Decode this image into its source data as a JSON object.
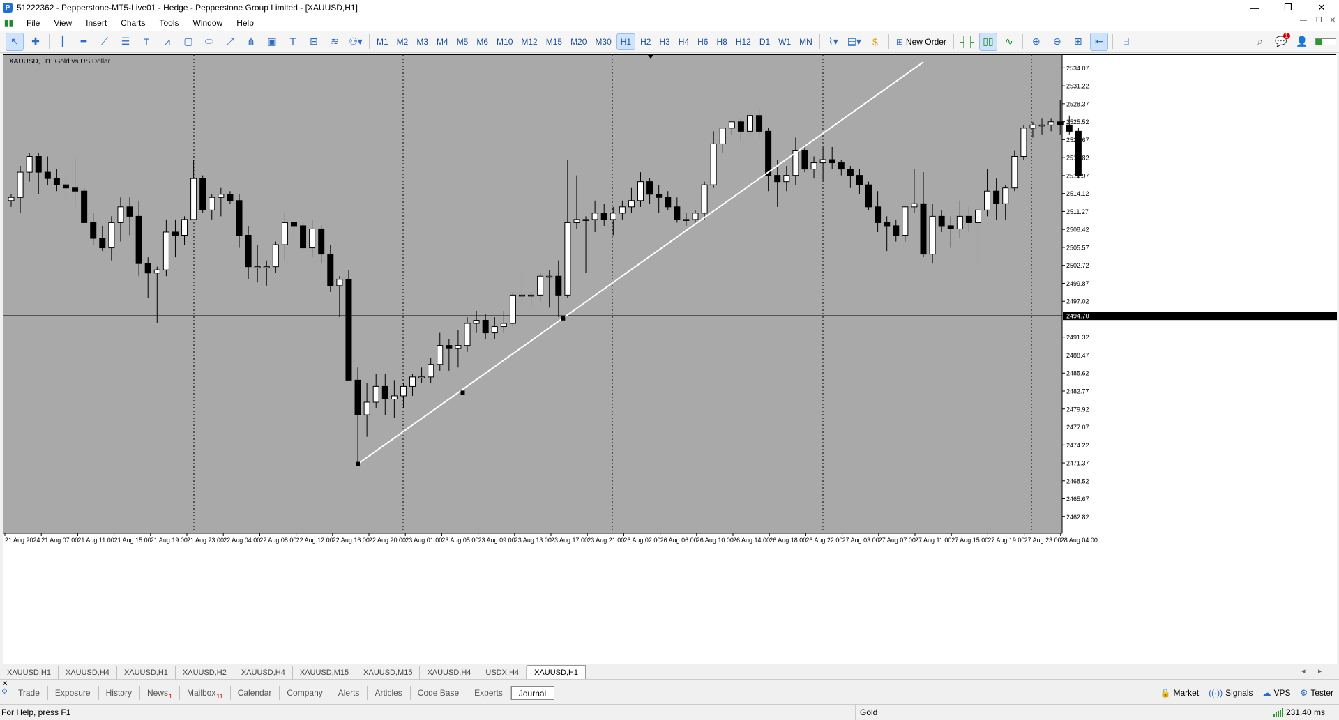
{
  "window": {
    "title": "51222362 - Pepperstone-MT5-Live01 - Hedge - Pepperstone Group Limited - [XAUUSD,H1]",
    "minimize": "—",
    "maximize": "❐",
    "close": "✕"
  },
  "menu": {
    "items": [
      "File",
      "View",
      "Insert",
      "Charts",
      "Tools",
      "Window",
      "Help"
    ]
  },
  "toolbar": {
    "drawing_tools": [
      "cursor-icon",
      "crosshair-icon",
      "vertical-line-icon",
      "horizontal-line-icon",
      "trendline-icon",
      "channel-icon",
      "text-icon",
      "fibonacci-icon",
      "rectangle-icon",
      "ellipse-icon",
      "arrow-icon",
      "pitchfork-icon",
      "gann-icon",
      "text-label-icon",
      "cycle-lines-icon",
      "regression-icon",
      "shapes-icon"
    ],
    "timeframes": [
      "M1",
      "M2",
      "M3",
      "M4",
      "M5",
      "M6",
      "M10",
      "M12",
      "M15",
      "M20",
      "M30",
      "H1",
      "H2",
      "H3",
      "H4",
      "H6",
      "H8",
      "H12",
      "D1",
      "W1",
      "MN"
    ],
    "active_timeframe": "H1",
    "new_order_label": "New Order",
    "notification_count": "1"
  },
  "chart": {
    "label": "XAUUSD, H1:  Gold vs US Dollar",
    "current_price": "2494.70",
    "bg_color": "#a9a9a9",
    "bull_color": "#ffffff",
    "bear_color": "#000000"
  },
  "chart_data": {
    "type": "candlestick",
    "symbol": "XAUUSD",
    "timeframe": "H1",
    "ylim": [
      2460.2,
      2536.1
    ],
    "y_ticks": [
      "2534.07",
      "2531.22",
      "2528.37",
      "2525.52",
      "2522.67",
      "2519.82",
      "2516.97",
      "2514.12",
      "2511.27",
      "2508.42",
      "2505.57",
      "2502.72",
      "2499.87",
      "2497.02",
      "2494.70",
      "2491.32",
      "2488.47",
      "2485.62",
      "2482.77",
      "2479.92",
      "2477.07",
      "2474.22",
      "2471.37",
      "2468.52",
      "2465.67",
      "2462.82"
    ],
    "x_ticks": [
      "21 Aug 2024",
      "21 Aug 07:00",
      "21 Aug 11:00",
      "21 Aug 15:00",
      "21 Aug 19:00",
      "21 Aug 23:00",
      "22 Aug 04:00",
      "22 Aug 08:00",
      "22 Aug 12:00",
      "22 Aug 16:00",
      "22 Aug 20:00",
      "23 Aug 01:00",
      "23 Aug 05:00",
      "23 Aug 09:00",
      "23 Aug 13:00",
      "23 Aug 17:00",
      "23 Aug 21:00",
      "26 Aug 02:00",
      "26 Aug 06:00",
      "26 Aug 10:00",
      "26 Aug 14:00",
      "26 Aug 18:00",
      "26 Aug 22:00",
      "27 Aug 03:00",
      "27 Aug 07:00",
      "27 Aug 11:00",
      "27 Aug 15:00",
      "27 Aug 19:00",
      "27 Aug 23:00",
      "28 Aug 04:00"
    ],
    "horizontal_line": 2494.7,
    "candles": [
      [
        2513.0,
        2514.0,
        2512.0,
        2513.5
      ],
      [
        2513.5,
        2518.5,
        2511.0,
        2517.5
      ],
      [
        2517.5,
        2520.5,
        2516.0,
        2520.0
      ],
      [
        2520.0,
        2520.5,
        2514.0,
        2517.5
      ],
      [
        2517.5,
        2520.0,
        2515.5,
        2516.5
      ],
      [
        2516.5,
        2518.0,
        2514.5,
        2515.5
      ],
      [
        2515.5,
        2517.5,
        2512.5,
        2515.0
      ],
      [
        2515.0,
        2520.0,
        2512.0,
        2514.5
      ],
      [
        2514.5,
        2515.0,
        2509.5,
        2509.5
      ],
      [
        2509.5,
        2511.0,
        2506.0,
        2507.0
      ],
      [
        2507.0,
        2509.0,
        2505.0,
        2505.5
      ],
      [
        2505.5,
        2510.5,
        2503.5,
        2509.5
      ],
      [
        2509.5,
        2513.5,
        2506.5,
        2512.0
      ],
      [
        2512.0,
        2513.5,
        2507.5,
        2510.5
      ],
      [
        2510.5,
        2513.0,
        2501.0,
        2503.0
      ],
      [
        2503.0,
        2504.0,
        2497.5,
        2501.5
      ],
      [
        2501.5,
        2502.5,
        2493.5,
        2502.0
      ],
      [
        2502.0,
        2510.0,
        2501.0,
        2508.0
      ],
      [
        2508.0,
        2510.0,
        2504.0,
        2507.5
      ],
      [
        2507.5,
        2510.5,
        2506.0,
        2510.0
      ],
      [
        2510.0,
        2519.5,
        2510.0,
        2516.5
      ],
      [
        2516.5,
        2517.0,
        2511.0,
        2511.5
      ],
      [
        2511.5,
        2514.0,
        2510.0,
        2513.5
      ],
      [
        2513.5,
        2515.0,
        2510.5,
        2514.0
      ],
      [
        2514.0,
        2514.5,
        2512.5,
        2513.0
      ],
      [
        2513.0,
        2514.0,
        2505.5,
        2507.5
      ],
      [
        2507.5,
        2509.0,
        2500.5,
        2502.5
      ],
      [
        2502.5,
        2506.0,
        2500.0,
        2502.5
      ],
      [
        2502.5,
        2503.5,
        2499.5,
        2502.5
      ],
      [
        2502.5,
        2506.5,
        2501.5,
        2506.0
      ],
      [
        2506.0,
        2511.0,
        2503.5,
        2509.5
      ],
      [
        2509.5,
        2510.0,
        2506.0,
        2509.0
      ],
      [
        2509.0,
        2509.5,
        2505.5,
        2505.5
      ],
      [
        2505.5,
        2510.0,
        2504.0,
        2508.5
      ],
      [
        2508.5,
        2509.0,
        2503.0,
        2504.5
      ],
      [
        2504.5,
        2506.0,
        2498.5,
        2499.5
      ],
      [
        2499.5,
        2501.0,
        2494.5,
        2500.5
      ],
      [
        2500.5,
        2502.0,
        2484.5,
        2484.5
      ],
      [
        2484.5,
        2486.5,
        2471.5,
        2479.0
      ],
      [
        2479.0,
        2484.0,
        2475.5,
        2481.0
      ],
      [
        2481.0,
        2485.5,
        2480.0,
        2483.5
      ],
      [
        2483.5,
        2485.5,
        2479.0,
        2481.5
      ],
      [
        2481.5,
        2484.5,
        2478.5,
        2482.0
      ],
      [
        2482.0,
        2484.0,
        2480.0,
        2483.5
      ],
      [
        2483.5,
        2485.5,
        2482.0,
        2485.0
      ],
      [
        2485.0,
        2486.5,
        2484.0,
        2485.0
      ],
      [
        2485.0,
        2488.0,
        2484.0,
        2487.0
      ],
      [
        2487.0,
        2492.0,
        2486.0,
        2490.0
      ],
      [
        2490.0,
        2491.0,
        2486.0,
        2489.5
      ],
      [
        2489.5,
        2492.5,
        2486.5,
        2490.0
      ],
      [
        2490.0,
        2494.5,
        2489.0,
        2493.5
      ],
      [
        2493.5,
        2495.5,
        2492.0,
        2494.0
      ],
      [
        2494.0,
        2495.0,
        2491.0,
        2492.0
      ],
      [
        2492.0,
        2494.5,
        2491.0,
        2493.0
      ],
      [
        2493.0,
        2495.5,
        2492.0,
        2493.5
      ],
      [
        2493.5,
        2498.5,
        2493.0,
        2498.0
      ],
      [
        2498.0,
        2502.0,
        2496.5,
        2498.0
      ],
      [
        2498.0,
        2498.5,
        2496.0,
        2498.0
      ],
      [
        2498.0,
        2501.5,
        2497.0,
        2501.0
      ],
      [
        2501.0,
        2502.0,
        2496.0,
        2501.0
      ],
      [
        2501.0,
        2503.5,
        2494.5,
        2498.0
      ],
      [
        2498.0,
        2519.5,
        2497.5,
        2509.5
      ],
      [
        2509.5,
        2517.0,
        2508.5,
        2510.0
      ],
      [
        2510.0,
        2510.5,
        2501.5,
        2510.0
      ],
      [
        2510.0,
        2513.0,
        2508.0,
        2511.0
      ],
      [
        2511.0,
        2512.5,
        2509.0,
        2510.0
      ],
      [
        2510.0,
        2512.0,
        2507.5,
        2511.0
      ],
      [
        2511.0,
        2513.0,
        2510.0,
        2512.0
      ],
      [
        2512.0,
        2515.0,
        2511.0,
        2513.0
      ],
      [
        2513.0,
        2517.5,
        2512.0,
        2516.0
      ],
      [
        2516.0,
        2516.5,
        2512.5,
        2514.0
      ],
      [
        2514.0,
        2515.5,
        2511.0,
        2513.5
      ],
      [
        2513.5,
        2514.5,
        2511.5,
        2512.0
      ],
      [
        2512.0,
        2513.5,
        2509.5,
        2510.0
      ],
      [
        2510.0,
        2511.0,
        2509.0,
        2510.0
      ],
      [
        2510.0,
        2511.5,
        2509.5,
        2511.0
      ],
      [
        2511.0,
        2516.0,
        2510.0,
        2515.5
      ],
      [
        2515.5,
        2524.0,
        2515.0,
        2522.0
      ],
      [
        2522.0,
        2524.5,
        2520.5,
        2524.5
      ],
      [
        2524.5,
        2525.5,
        2523.5,
        2525.5
      ],
      [
        2525.5,
        2526.0,
        2522.5,
        2524.0
      ],
      [
        2524.0,
        2527.0,
        2523.0,
        2526.5
      ],
      [
        2526.5,
        2527.5,
        2523.0,
        2524.0
      ],
      [
        2524.0,
        2524.5,
        2514.5,
        2517.0
      ],
      [
        2517.0,
        2519.5,
        2512.0,
        2516.0
      ],
      [
        2516.0,
        2518.5,
        2514.5,
        2517.0
      ],
      [
        2517.0,
        2523.0,
        2515.5,
        2521.0
      ],
      [
        2521.0,
        2521.5,
        2517.5,
        2518.0
      ],
      [
        2518.0,
        2520.0,
        2516.5,
        2519.0
      ],
      [
        2519.0,
        2521.5,
        2516.0,
        2519.5
      ],
      [
        2519.5,
        2521.5,
        2518.0,
        2519.0
      ],
      [
        2519.0,
        2519.5,
        2517.0,
        2518.0
      ],
      [
        2518.0,
        2518.5,
        2515.0,
        2517.0
      ],
      [
        2517.0,
        2518.0,
        2514.0,
        2515.5
      ],
      [
        2515.5,
        2516.0,
        2511.5,
        2512.0
      ],
      [
        2512.0,
        2514.5,
        2508.0,
        2509.5
      ],
      [
        2509.5,
        2510.5,
        2505.0,
        2509.0
      ],
      [
        2509.0,
        2510.0,
        2506.5,
        2507.5
      ],
      [
        2507.5,
        2512.0,
        2506.5,
        2512.0
      ],
      [
        2512.0,
        2518.0,
        2511.0,
        2512.5
      ],
      [
        2512.5,
        2517.5,
        2504.0,
        2504.5
      ],
      [
        2504.5,
        2512.5,
        2503.0,
        2510.5
      ],
      [
        2510.5,
        2511.5,
        2508.0,
        2509.0
      ],
      [
        2509.0,
        2510.5,
        2505.5,
        2508.5
      ],
      [
        2508.5,
        2513.0,
        2507.0,
        2510.5
      ],
      [
        2510.5,
        2512.0,
        2508.0,
        2509.5
      ],
      [
        2509.5,
        2512.5,
        2503.0,
        2511.5
      ],
      [
        2511.5,
        2518.0,
        2510.5,
        2514.5
      ],
      [
        2514.5,
        2516.5,
        2510.0,
        2512.5
      ],
      [
        2512.5,
        2515.5,
        2510.0,
        2515.0
      ],
      [
        2515.0,
        2521.0,
        2514.5,
        2520.0
      ],
      [
        2520.0,
        2525.0,
        2519.5,
        2524.5
      ],
      [
        2524.5,
        2525.5,
        2523.0,
        2525.0
      ],
      [
        2525.0,
        2526.0,
        2523.5,
        2525.0
      ],
      [
        2525.0,
        2526.0,
        2524.0,
        2525.5
      ],
      [
        2525.5,
        2529.0,
        2523.5,
        2525.0
      ],
      [
        2525.0,
        2526.5,
        2523.5,
        2524.0
      ],
      [
        2524.0,
        2524.5,
        2516.5,
        2517.0
      ]
    ],
    "trendline": {
      "from": [
        38,
        2471.2
      ],
      "to": [
        100,
        2535.0
      ],
      "anchors": [
        [
          38,
          2471.2
        ],
        [
          49.5,
          2482.5
        ],
        [
          60.5,
          2494.3
        ]
      ]
    }
  },
  "symbol_tabs": [
    "XAUUSD,H1",
    "XAUUSD,H4",
    "XAUUSD,H1",
    "XAUUSD,H2",
    "XAUUSD,H4",
    "XAUUSD,M15",
    "XAUUSD,M15",
    "XAUUSD,H4",
    "USDX,H4",
    "XAUUSD,H1"
  ],
  "active_symbol_tab": 9,
  "toolbox": {
    "tabs": [
      {
        "label": "Trade",
        "badge": ""
      },
      {
        "label": "Exposure",
        "badge": ""
      },
      {
        "label": "History",
        "badge": ""
      },
      {
        "label": "News",
        "badge": "1"
      },
      {
        "label": "Mailbox",
        "badge": "11"
      },
      {
        "label": "Calendar",
        "badge": ""
      },
      {
        "label": "Company",
        "badge": ""
      },
      {
        "label": "Alerts",
        "badge": ""
      },
      {
        "label": "Articles",
        "badge": ""
      },
      {
        "label": "Code Base",
        "badge": ""
      },
      {
        "label": "Experts",
        "badge": ""
      },
      {
        "label": "Journal",
        "badge": ""
      }
    ],
    "active_tab": 11,
    "right": {
      "market": "Market",
      "signals": "Signals",
      "vps": "VPS",
      "tester": "Tester"
    },
    "close": "✕"
  },
  "status": {
    "help": "For Help, press F1",
    "symbol_name": "Gold",
    "ping": "231.40 ms"
  }
}
